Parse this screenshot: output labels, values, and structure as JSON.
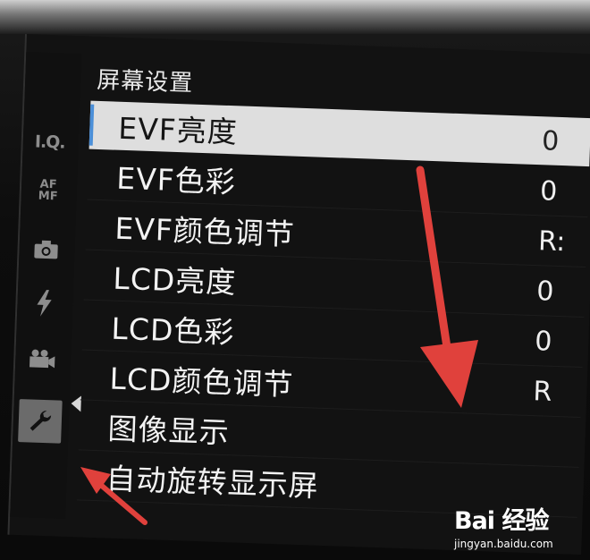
{
  "screen": {
    "title": "屏幕设置",
    "sidebar": {
      "iq_label": "I.Q.",
      "af_label": "AF",
      "mf_label": "MF",
      "icons": [
        "camera-icon",
        "flash-icon",
        "video-icon",
        "wrench-icon"
      ],
      "active": "wrench-icon"
    },
    "menu": [
      {
        "label": "EVF亮度",
        "value": "0",
        "selected": true
      },
      {
        "label": "EVF色彩",
        "value": "0"
      },
      {
        "label": "EVF颜色调节",
        "value": "R:"
      },
      {
        "label": "LCD亮度",
        "value": "0"
      },
      {
        "label": "LCD色彩",
        "value": "0"
      },
      {
        "label": "LCD颜色调节",
        "value": "R"
      },
      {
        "label": "图像显示",
        "value": ""
      },
      {
        "label": "自动旋转显示屏",
        "value": ""
      }
    ]
  },
  "watermark": {
    "logo": "Bai 经验",
    "site": "jingyan.baidu.com"
  },
  "colors": {
    "selected_row": "#dedede",
    "accent_blue": "#4b8fd8",
    "annotation_red": "#e0413c"
  }
}
